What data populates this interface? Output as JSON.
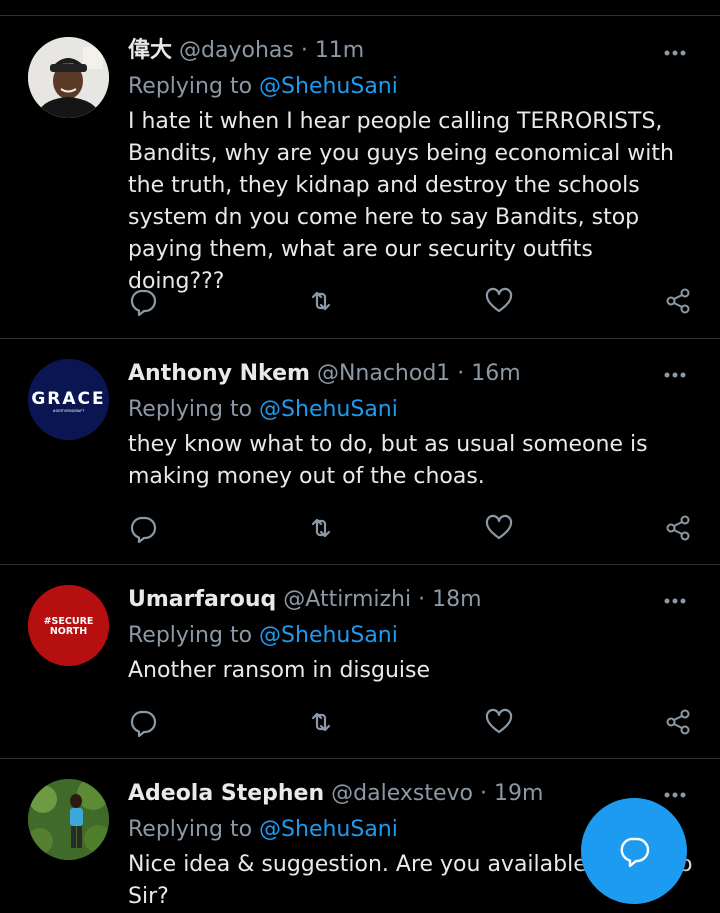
{
  "colors": {
    "background": "#000000",
    "divider": "#2f3336",
    "name": "#e7e9ea",
    "muted": "#8b98a5",
    "mention": "#1d9bf0",
    "fab": "#1d9bf0"
  },
  "tweets": [
    {
      "name": "偉大",
      "handle": "@dayohas",
      "time": "· 11m",
      "replying_label": "Replying to",
      "replying_to": "@ShehuSani",
      "text": "I hate it when I hear people calling TERRORISTS, Bandits, why are you guys being economical with the truth, they kidnap and destroy the schools system dn you come here to say Bandits, stop paying them, what are our security outfits doing???",
      "avatar": "photo-man-cap"
    },
    {
      "name": "Anthony Nkem",
      "handle": "@Nnachod1",
      "time": "· 16m",
      "replying_label": "Replying to",
      "replying_to": "@ShehuSani",
      "text": "they know what to do, but as usual someone is making money out of the choas.",
      "avatar": "logo",
      "avatar_text": "GRACE",
      "avatar_subtext": "#GRITVERSKRAFT"
    },
    {
      "name": "Umarfarouq",
      "handle": "@Attirmizhi",
      "time": "· 18m",
      "replying_label": "Replying to",
      "replying_to": "@ShehuSani",
      "text": "Another ransom in disguise",
      "avatar": "logo",
      "avatar_text_line1": "#SECURE",
      "avatar_text_line2": "NORTH"
    },
    {
      "name": "Adeola Stephen",
      "handle": "@dalexstevo",
      "time": "· 19m",
      "replying_label": "Replying to",
      "replying_to": "@ShehuSani",
      "text": "Nice idea & suggestion. Are you available f... o Sir?",
      "text_line1": "Nice idea & suggestion. Are you available",
      "text_line1_tail": "f",
      "text_line1_end": "o",
      "text_line2": "Sir?",
      "avatar": "photo-man-outdoors"
    }
  ],
  "icons": {
    "more": "more-horizontal-icon",
    "reply": "reply-icon",
    "retweet": "retweet-icon",
    "like": "heart-icon",
    "share": "share-icon",
    "compose": "compose-reply-icon"
  }
}
